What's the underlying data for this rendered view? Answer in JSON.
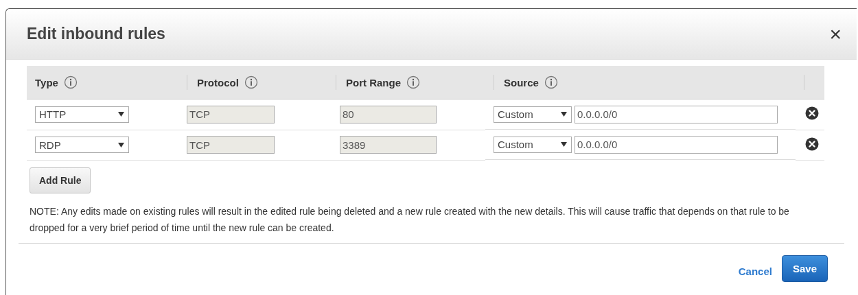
{
  "dialog": {
    "title": "Edit inbound rules",
    "close": "×"
  },
  "table": {
    "columns": [
      "Type",
      "Protocol",
      "Port Range",
      "Source"
    ],
    "rows": [
      {
        "type": "HTTP",
        "protocol": {
          "value": "TCP",
          "disabled": true
        },
        "port_range": {
          "value": "80",
          "disabled": true
        },
        "source": "Custom",
        "cidr": {
          "value": "0.0.0.0/0",
          "disabled": false
        }
      },
      {
        "type": "RDP",
        "protocol": {
          "value": "TCP",
          "disabled": true
        },
        "port_range": {
          "value": "3389",
          "disabled": true
        },
        "source": "Custom",
        "cidr": {
          "value": "0.0.0.0/0",
          "disabled": false
        }
      }
    ]
  },
  "add_rule": "Add Rule",
  "note": "NOTE: Any edits made on existing rules will result in the edited rule being deleted and a new rule created with the new details. This will cause traffic that depends on that rule to be dropped for a very brief period of time until the new rule can be created.",
  "buttons": {
    "cancel": "Cancel",
    "save": "Save"
  }
}
